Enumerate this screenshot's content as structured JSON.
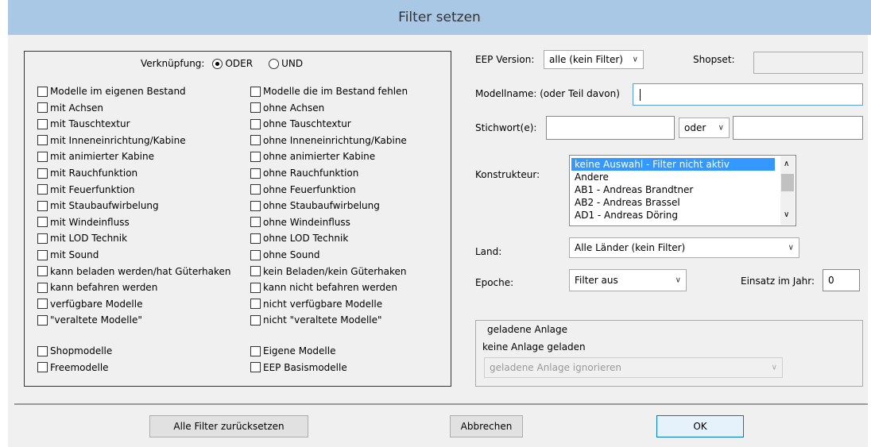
{
  "window": {
    "title": "Filter setzen"
  },
  "left": {
    "verknuepfung_label": "Verknüpfung:",
    "radio_oder": "ODER",
    "radio_und": "UND",
    "col1": [
      "Modelle im eigenen Bestand",
      "mit Achsen",
      "mit Tauschtextur",
      "mit Inneneinrichtung/Kabine",
      "mit animierter Kabine",
      "mit Rauchfunktion",
      "mit Feuerfunktion",
      "mit Staubaufwirbelung",
      "mit Windeinfluss",
      "mit LOD Technik",
      "mit Sound",
      "kann beladen werden/hat Güterhaken",
      "kann befahren werden",
      "verfügbare Modelle",
      "\"veraltete Modelle\""
    ],
    "col2": [
      "Modelle die im Bestand fehlen",
      "ohne Achsen",
      "ohne Tauschtextur",
      "ohne Inneneinrichtung/Kabine",
      "ohne animierter Kabine",
      "ohne Rauchfunktion",
      "ohne Feuerfunktion",
      "ohne Staubaufwirbelung",
      "ohne Windeinfluss",
      "ohne LOD Technik",
      "ohne Sound",
      "kein Beladen/kein Güterhaken",
      "kann nicht befahren werden",
      "nicht verfügbare Modelle",
      "nicht \"veraltete Modelle\""
    ],
    "shop_col1": [
      "Shopmodelle",
      "Freemodelle"
    ],
    "shop_col2": [
      "Eigene Modelle",
      "EEP Basismodelle"
    ]
  },
  "right": {
    "eep_version_label": "EEP Version:",
    "eep_version_value": "alle (kein Filter)",
    "shopset_label": "Shopset:",
    "shopset_value": "",
    "modellname_label": "Modellname: (oder Teil davon)",
    "modellname_value": "",
    "stichwort_label": "Stichwort(e):",
    "stichwort_value1": "",
    "stichwort_op": "oder",
    "stichwort_value2": "",
    "konstrukteur_label": "Konstrukteur:",
    "konstrukteur_items": [
      "keine Auswahl - Filter nicht aktiv",
      "Andere",
      "AB1 - Andreas Brandtner",
      "AB2 - Andreas Brassel",
      "AD1 - Andreas Döring"
    ],
    "land_label": "Land:",
    "land_value": "Alle Länder (kein Filter)",
    "epoche_label": "Epoche:",
    "epoche_value": "Filter aus",
    "einsatz_label": "Einsatz im Jahr:",
    "einsatz_value": "0",
    "group_title": "geladene Anlage",
    "group_status": "keine Anlage geladen",
    "group_select": "geladene Anlage ignorieren"
  },
  "buttons": {
    "reset": "Alle Filter zurücksetzen",
    "cancel": "Abbrechen",
    "ok": "OK"
  },
  "colors": {
    "title_bar": "#a9c8e6",
    "dialog_bg": "#f0f0f0",
    "selection": "#3399ff",
    "ok_border": "#0078d7"
  }
}
